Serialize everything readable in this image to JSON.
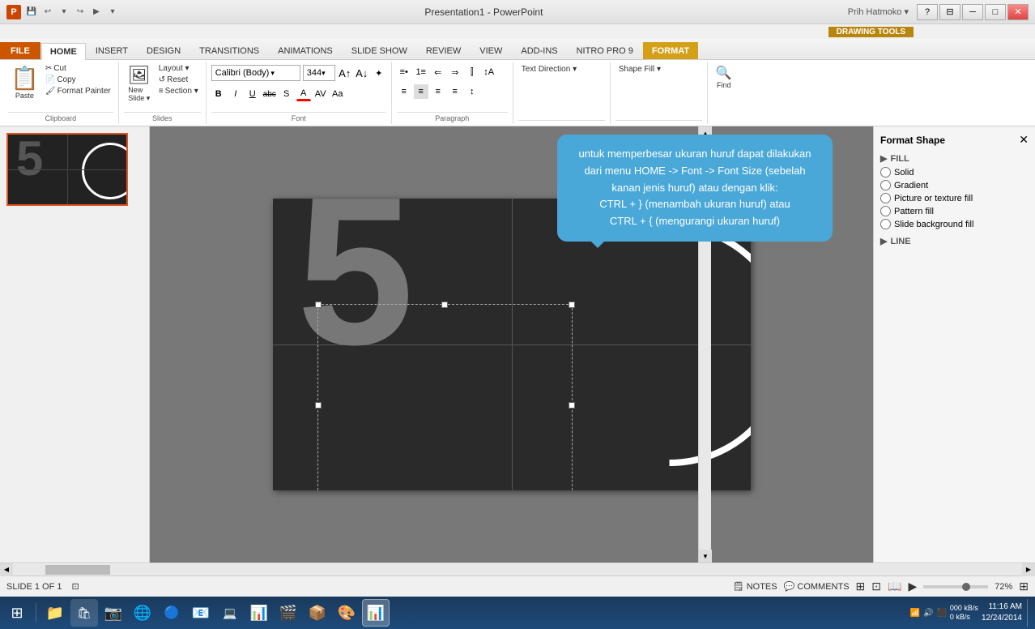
{
  "titlebar": {
    "title": "Presentation1 - PowerPoint",
    "drawing_tools": "DRAWING TOOLS"
  },
  "tabs": {
    "file": "FILE",
    "home": "HOME",
    "insert": "INSERT",
    "design": "DESIGN",
    "transitions": "TRANSITIONS",
    "animations": "ANIMATIONS",
    "slideshow": "SLIDE SHOW",
    "review": "REVIEW",
    "view": "VIEW",
    "addins": "ADD-INS",
    "nitro": "NITRO PRO 9",
    "format": "FORMAT"
  },
  "ribbon": {
    "clipboard": {
      "label": "Clipboard",
      "paste": "Paste",
      "cut": "Cut",
      "copy": "Copy",
      "format_painter": "Format Painter"
    },
    "slides": {
      "label": "Slides",
      "new_slide": "New Slide",
      "layout": "Layout ▾",
      "reset": "Reset",
      "section": "Section ▾"
    },
    "font": {
      "label": "Font",
      "name": "Calibri (Body)",
      "size": "344",
      "bold": "B",
      "italic": "I",
      "underline": "U",
      "strikethrough": "abc",
      "shadow": "S"
    },
    "paragraph": {
      "label": "Paragraph"
    }
  },
  "tooltip": {
    "text": "untuk memperbesar ukuran huruf dapat dilakukan dari menu HOME -> Font -> Font Size (sebelah kanan jenis huruf) atau  dengan klik:\nCTRL + } (menambah ukuran huruf) atau\nCTRL + { (mengurangi ukuran huruf)"
  },
  "right_panel": {
    "fill_section": "FILL",
    "fill_options": [
      "Solid",
      "Gradient",
      "Picture or texture fill",
      "Pattern fill",
      "Slide background fill"
    ],
    "line_section": "LINE"
  },
  "statusbar": {
    "slide_info": "SLIDE 1 OF 1",
    "notes": "NOTES",
    "comments": "COMMENTS",
    "zoom": "72%"
  },
  "taskbar": {
    "apps": [
      "⊞",
      "📁",
      "🛍",
      "📷",
      "🌐",
      "🔵",
      "📨",
      "💻",
      "📎",
      "🎯",
      "📮",
      "🎨",
      "💻"
    ],
    "time": "11:16 AM",
    "date": "12/24/2014"
  }
}
